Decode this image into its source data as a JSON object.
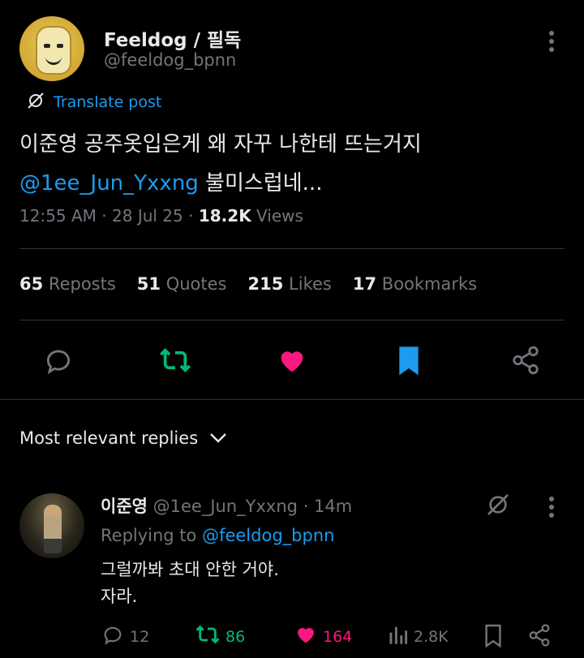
{
  "post": {
    "author_name": "Feeldog / 필독",
    "author_handle": "@feeldog_bpnn",
    "translate_label": "Translate post",
    "text_line1": "이준영 공주옷입은게 왜 자꾸 나한테 뜨는거지",
    "mention": "@1ee_Jun_Yxxng",
    "text_line2_rest": " 불미스럽네...",
    "time": "12:55 AM",
    "date": "28 Jul 25",
    "views_count": "18.2K",
    "views_label": "Views"
  },
  "stats": {
    "reposts_count": "65",
    "reposts_label": "Reposts",
    "quotes_count": "51",
    "quotes_label": "Quotes",
    "likes_count": "215",
    "likes_label": "Likes",
    "bookmarks_count": "17",
    "bookmarks_label": "Bookmarks"
  },
  "replies_sort_label": "Most relevant replies",
  "reply": {
    "author_name": "이준영",
    "author_handle": "@1ee_Jun_Yxxng",
    "age": "14m",
    "replying_prefix": "Replying to ",
    "replying_handle": "@feeldog_bpnn",
    "text_line1": "그럴까봐 초대 안한 거야.",
    "text_line2": "자라.",
    "reply_count": "12",
    "repost_count": "86",
    "like_count": "164",
    "view_count": "2.8K"
  },
  "colors": {
    "accent": "#1d9bf0",
    "repost_green": "#00ba7c",
    "like_pink": "#f91880",
    "muted": "#71767b"
  }
}
